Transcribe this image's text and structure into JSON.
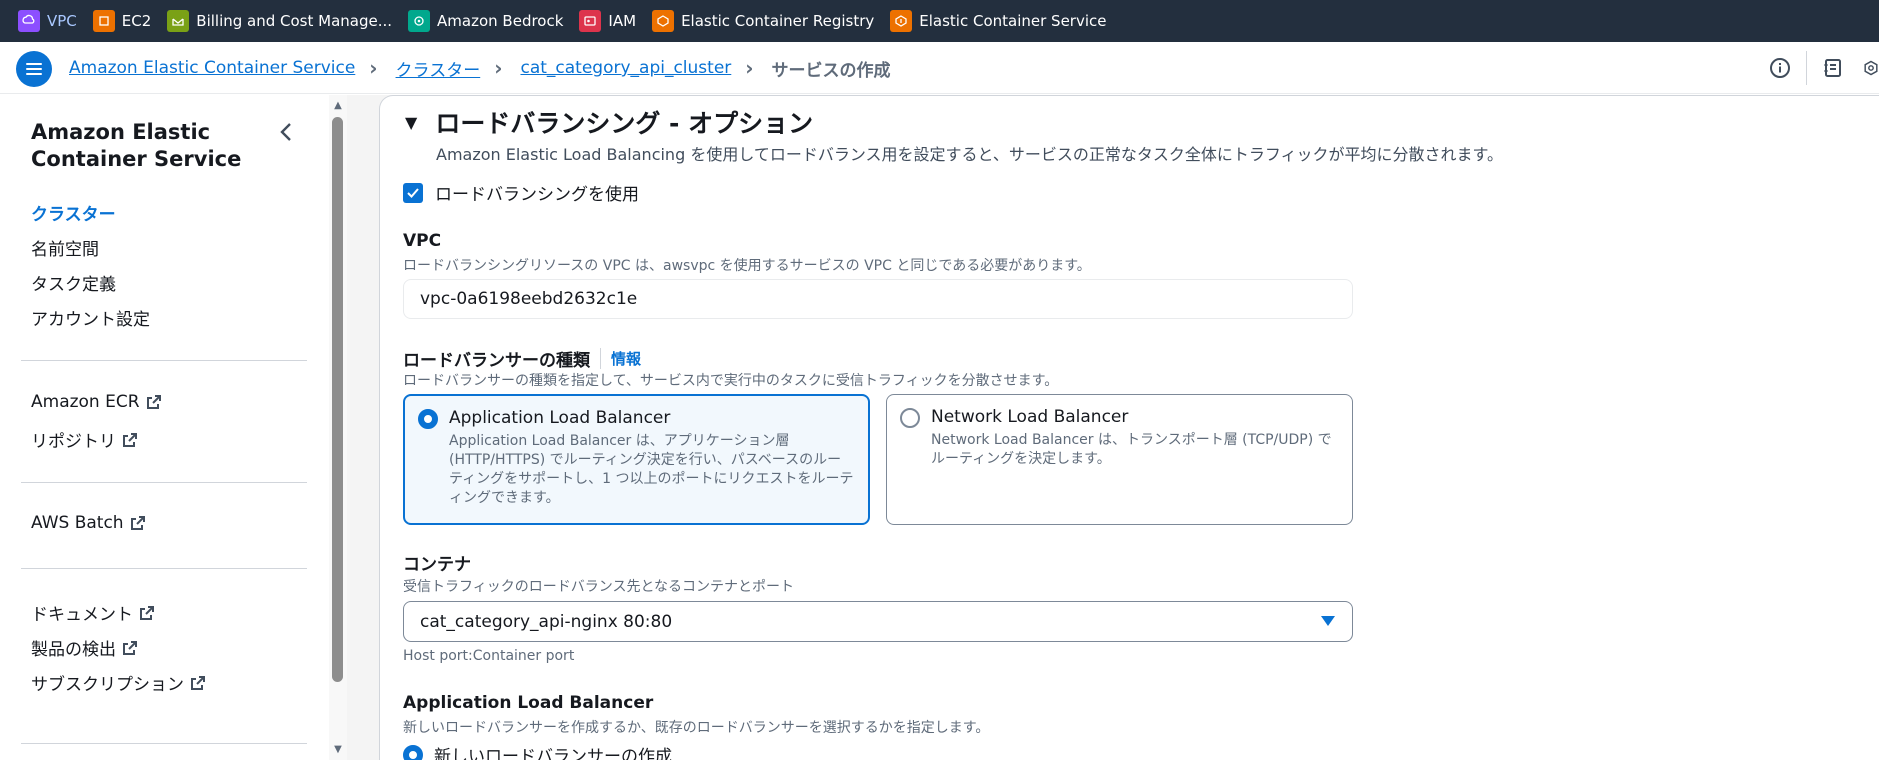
{
  "service_bar": [
    {
      "label": "VPC",
      "icon": "vpc-icon",
      "color": "#8c4fff"
    },
    {
      "label": "EC2",
      "icon": "ec2-icon",
      "color": "#ed7100"
    },
    {
      "label": "Billing and Cost Manage...",
      "icon": "billing-icon",
      "color": "#7aa116"
    },
    {
      "label": "Amazon Bedrock",
      "icon": "bedrock-icon",
      "color": "#01a88d"
    },
    {
      "label": "IAM",
      "icon": "iam-icon",
      "color": "#dd344c"
    },
    {
      "label": "Elastic Container Registry",
      "icon": "ecr-icon",
      "color": "#ed7100"
    },
    {
      "label": "Elastic Container Service",
      "icon": "ecs-icon",
      "color": "#ed7100"
    }
  ],
  "breadcrumb": {
    "items": [
      "Amazon Elastic Container Service",
      "クラスター",
      "cat_category_api_cluster"
    ],
    "current": "サービスの作成"
  },
  "sidenav": {
    "title": "Amazon Elastic Container Service",
    "group1": [
      "クラスター",
      "名前空間",
      "タスク定義",
      "アカウント設定"
    ],
    "group2": [
      "Amazon ECR",
      "リポジトリ"
    ],
    "group3": [
      "AWS Batch"
    ],
    "group4": [
      "ドキュメント",
      "製品の検出",
      "サブスクリプション"
    ]
  },
  "section": {
    "title": "ロードバランシング - オプション",
    "description": "Amazon Elastic Load Balancing を使用してロードバランス用を設定すると、サービスの正常なタスク全体にトラフィックが平均に分散されます。",
    "use_lb_label": "ロードバランシングを使用",
    "use_lb_checked": true
  },
  "vpc": {
    "label": "VPC",
    "description": "ロードバランシングリソースの VPC は、awsvpc を使用するサービスの VPC と同じである必要があります。",
    "value": "vpc-0a6198eebd2632c1e"
  },
  "lb_type": {
    "label": "ロードバランサーの種類",
    "info": "情報",
    "description": "ロードバランサーの種類を指定して、サービス内で実行中のタスクに受信トラフィックを分散させます。",
    "options": [
      {
        "title": "Application Load Balancer",
        "desc": "Application Load Balancer は、アプリケーション層 (HTTP/HTTPS) でルーティング決定を行い、パスベースのルーティングをサポートし、1 つ以上のポートにリクエストをルーティングできます。",
        "selected": true
      },
      {
        "title": "Network Load Balancer",
        "desc": "Network Load Balancer は、トランスポート層 (TCP/UDP) でルーティングを決定します。",
        "selected": false
      }
    ]
  },
  "container": {
    "label": "コンテナ",
    "description": "受信トラフィックのロードバランス先となるコンテナとポート",
    "value": "cat_category_api-nginx 80:80",
    "hint": "Host port:Container port"
  },
  "alb": {
    "label": "Application Load Balancer",
    "description": "新しいロードバランサーを作成するか、既存のロードバランサーを選択するかを指定します。",
    "option_new": "新しいロードバランサーの作成"
  },
  "colors": {
    "accent": "#0972d3",
    "topbar": "#232f3e"
  }
}
